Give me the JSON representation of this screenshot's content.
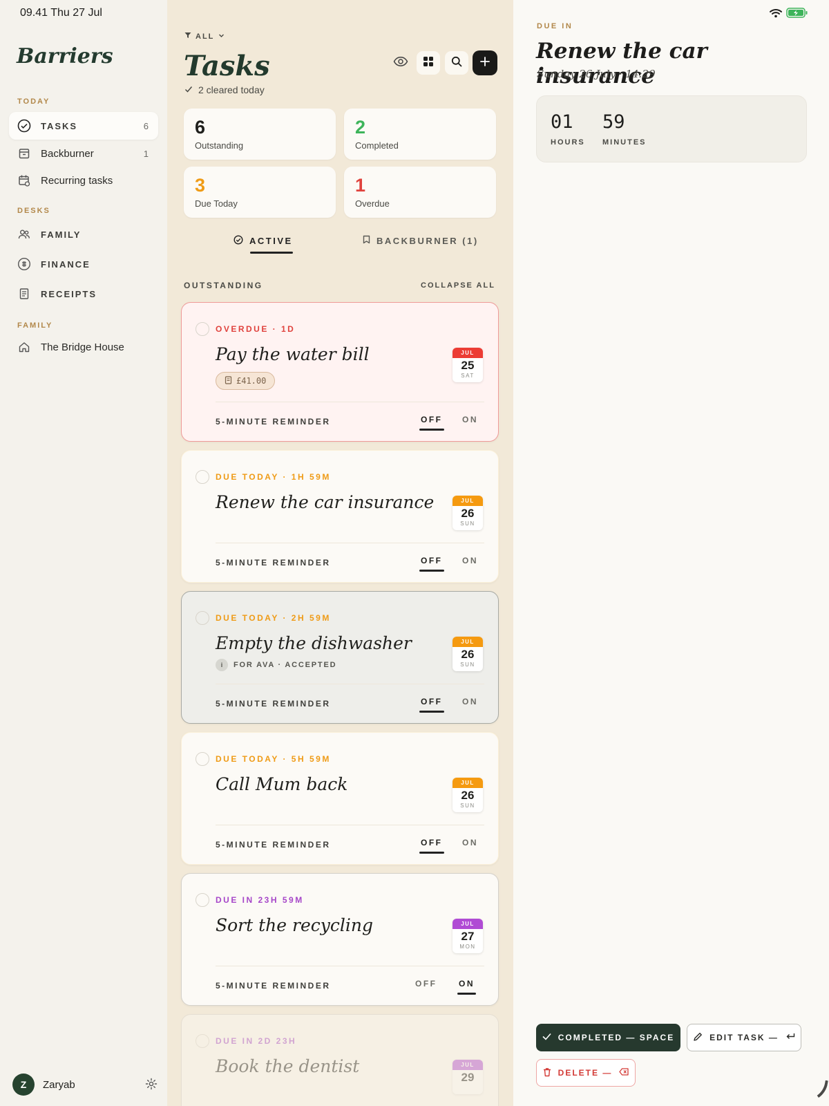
{
  "status": {
    "time": "09.41  Thu 27 Jul"
  },
  "sidebar": {
    "brand": "Barriers",
    "today_head": "TODAY",
    "tasks_label": "TASKS",
    "tasks_count": "6",
    "backburner_label": "Backburner",
    "backburner_count": "1",
    "recurring_label": "Recurring tasks",
    "desks_head": "DESKS",
    "family_label": "FAMILY",
    "finance_label": "FINANCE",
    "receipts_label": "RECEIPTS",
    "family_head": "FAMILY",
    "house_label": "The Bridge House",
    "user_initial": "Z",
    "user_name": "Zaryab"
  },
  "middle": {
    "filter": "ALL",
    "title": "Tasks",
    "cleared": "2 cleared today",
    "stats": [
      {
        "num": "6",
        "label": "Outstanding",
        "color": "#1f1f1c"
      },
      {
        "num": "2",
        "label": "Completed",
        "color": "#3db45a"
      },
      {
        "num": "3",
        "label": "Due Today",
        "color": "#ef9b16"
      },
      {
        "num": "1",
        "label": "Overdue",
        "color": "#e0423d"
      }
    ],
    "tab_active": "ACTIVE",
    "tab_backburner": "BACKBURNER (1)",
    "outstanding": "OUTSTANDING",
    "collapse_all": "COLLAPSE ALL",
    "reminder_label": "5-MINUTE REMINDER",
    "off": "OFF",
    "on": "ON"
  },
  "tasks": [
    {
      "due": "OVERDUE · 1D",
      "due_color": "#e0423d",
      "title": "Pay the water bill",
      "chip": "£41.00",
      "month": "JUL",
      "day": "25",
      "weekday": "SAT",
      "cal_color": "#ec3c34",
      "reminder_on": false
    },
    {
      "due": "DUE TODAY · 1H 59M",
      "due_color": "#ef9b16",
      "title": "Renew the car insurance",
      "month": "JUL",
      "day": "26",
      "weekday": "SUN",
      "cal_color": "#f59a10",
      "reminder_on": false
    },
    {
      "due": "DUE TODAY · 2H 59M",
      "due_color": "#ef9b16",
      "title": "Empty the dishwasher",
      "sub_initial": "i",
      "sub": "FOR AVA · ACCEPTED",
      "month": "JUL",
      "day": "26",
      "weekday": "SUN",
      "cal_color": "#f59a10",
      "reminder_on": false
    },
    {
      "due": "DUE TODAY · 5H 59M",
      "due_color": "#ef9b16",
      "title": "Call Mum back",
      "month": "JUL",
      "day": "26",
      "weekday": "SUN",
      "cal_color": "#f59a10",
      "reminder_on": false
    },
    {
      "due": "DUE IN 23H 59M",
      "due_color": "#a646c9",
      "title": "Sort the recycling",
      "month": "JUL",
      "day": "27",
      "weekday": "MON",
      "cal_color": "#b04bd4",
      "reminder_on": true
    },
    {
      "due": "DUE IN 2D 23H",
      "due_color": "#a646c9",
      "title": "Book the dentist",
      "month": "JUL",
      "day": "29",
      "weekday": "",
      "cal_color": "#b04bd4",
      "reminder_on": false
    }
  ],
  "detail": {
    "due_in": "DUE IN",
    "title": "Renew the car insurance",
    "when": "Sunday 26 July · 14:29",
    "hours": "01",
    "hours_label": "HOURS",
    "minutes": "59",
    "minutes_label": "MINUTES",
    "complete": "COMPLETED — SPACE",
    "edit": "EDIT TASK —",
    "delete": "DELETE —"
  }
}
